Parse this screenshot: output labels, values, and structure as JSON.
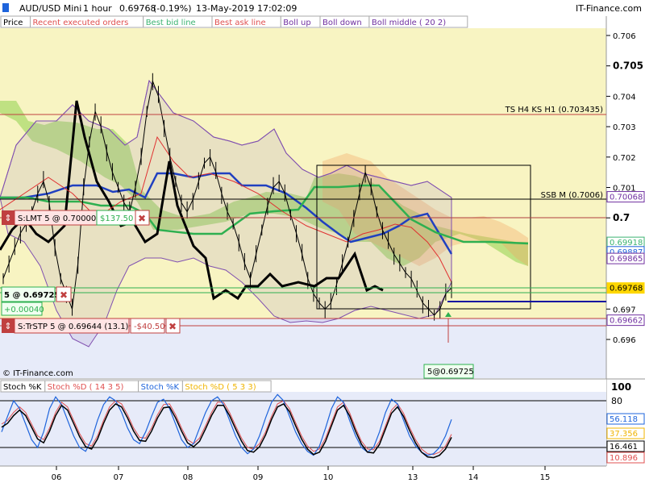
{
  "header": {
    "symbol": "AUD/USD Mini",
    "timeframe": "1 hour",
    "last_price": "0.69768",
    "change": "(-0.19%)",
    "datetime": "13-May-2019 17:02:09",
    "brand": "IT-Finance.com",
    "watermark": "© IT-Finance.com"
  },
  "legend": {
    "items": [
      {
        "label": "Price",
        "color": "#000000",
        "bg": "#ffffff"
      },
      {
        "label": "Recent executed orders",
        "color": "#e05050",
        "bg": "#ffffff"
      },
      {
        "label": "Best bid line",
        "color": "#3cb371",
        "bg": "#ffffff"
      },
      {
        "label": "Best ask line",
        "color": "#e05050",
        "bg": "#ffffff"
      },
      {
        "label": "Boll up",
        "color": "#7030a0",
        "bg": "#ffffff"
      },
      {
        "label": "Boll down",
        "color": "#7030a0",
        "bg": "#ffffff"
      },
      {
        "label": "Boll middle ( 20 2)",
        "color": "#7030a0",
        "bg": "#ffffff"
      }
    ]
  },
  "annotations": {
    "ts_label": "TS H4 KS H1 (0.703435)",
    "ssb_label": "SSB M (0.7006)"
  },
  "orders": {
    "limit_label": "S:LMT  5 @ 0.70000",
    "limit_value": "$137.50",
    "position_label": "5 @ 0.69725",
    "position_pnl": "+0.00040",
    "stop_label": "S:TrSTP  5 @ 0.69644 (13.1)",
    "stop_value": "-$40.50",
    "fill_label": "5@0.69725"
  },
  "stoch": {
    "legend": [
      {
        "label": "Stoch %K",
        "color": "#000000"
      },
      {
        "label": "Stoch %D ( 14 3 5)",
        "color": "#e05050"
      },
      {
        "label": "Stoch %K",
        "color": "#1e64dc"
      },
      {
        "label": "Stoch %D ( 5 3 3)",
        "color": "#f0b400"
      }
    ],
    "level_top": "100",
    "level_80": "80",
    "badges": [
      {
        "text": "56.118",
        "color": "#1e64dc"
      },
      {
        "text": "37.356",
        "color": "#f0b400"
      },
      {
        "text": "16.461",
        "color": "#000000"
      },
      {
        "text": "10.896",
        "color": "#e05050"
      }
    ]
  },
  "chart_data": {
    "type": "line",
    "symbol": "AUD/USD Mini",
    "interval": "1 hour",
    "ylim": [
      0.6955,
      0.7065
    ],
    "y_ticks": [
      "0.706",
      "0.705",
      "0.704",
      "0.703",
      "0.702",
      "0.701",
      "0.7",
      "0.697",
      "0.696"
    ],
    "x_tick_labels": [
      "06",
      "07",
      "08",
      "09",
      "10",
      "13",
      "14",
      "15"
    ],
    "price_badges": [
      {
        "text": "0.70068",
        "value": 0.70068,
        "color": "#7030a0"
      },
      {
        "text": "0.69918",
        "value": 0.69918,
        "color": "#3cb371"
      },
      {
        "text": "0.69887",
        "value": 0.69887,
        "color": "#1e64dc"
      },
      {
        "text": "0.69865",
        "value": 0.69865,
        "color": "#7030a0"
      },
      {
        "text": "0.69768",
        "value": 0.69768,
        "color": "#ffd700"
      },
      {
        "text": "0.69662",
        "value": 0.69662,
        "color": "#7030a0"
      }
    ],
    "horizontal_levels": [
      {
        "name": "TS H4 KS H1",
        "value": 0.703435
      },
      {
        "name": "SSB M",
        "value": 0.7006
      },
      {
        "name": "Limit order",
        "value": 0.7
      },
      {
        "name": "Position",
        "value": 0.69725
      },
      {
        "name": "Trailing stop",
        "value": 0.69644
      }
    ],
    "close_series": [
      0.698,
      0.6985,
      0.699,
      0.6995,
      0.6998,
      0.7002,
      0.7008,
      0.7012,
      0.7005,
      0.699,
      0.698,
      0.6975,
      0.697,
      0.6985,
      0.701,
      0.7025,
      0.7035,
      0.703,
      0.7022,
      0.7015,
      0.701,
      0.7005,
      0.7002,
      0.701,
      0.702,
      0.7035,
      0.7045,
      0.704,
      0.703,
      0.702,
      0.7012,
      0.7005,
      0.7002,
      0.7006,
      0.7012,
      0.7018,
      0.702,
      0.7015,
      0.7008,
      0.7002,
      0.6998,
      0.6992,
      0.6985,
      0.698,
      0.6988,
      0.6996,
      0.7004,
      0.701,
      0.7012,
      0.7008,
      0.7001,
      0.6995,
      0.6988,
      0.698,
      0.6975,
      0.6972,
      0.697,
      0.6972,
      0.6978,
      0.6985,
      0.6992,
      0.7,
      0.7008,
      0.7015,
      0.701,
      0.7002,
      0.6996,
      0.6992,
      0.6988,
      0.6985,
      0.6982,
      0.698,
      0.6976,
      0.6972,
      0.697,
      0.6968,
      0.697,
      0.6975,
      0.6977
    ],
    "stoch_k_series": [
      40,
      60,
      80,
      70,
      50,
      30,
      20,
      40,
      70,
      85,
      75,
      55,
      35,
      20,
      15,
      30,
      55,
      75,
      85,
      80,
      65,
      45,
      30,
      25,
      40,
      60,
      78,
      82,
      70,
      50,
      30,
      20,
      25,
      45,
      65,
      80,
      85,
      75,
      55,
      35,
      20,
      12,
      18,
      35,
      58,
      78,
      88,
      80,
      60,
      40,
      25,
      15,
      10,
      22,
      45,
      70,
      85,
      78,
      55,
      35,
      20,
      14,
      20,
      40,
      65,
      82,
      76,
      55,
      35,
      22,
      14,
      10,
      12,
      20,
      35,
      56
    ],
    "stoch_d_series": [
      50,
      55,
      65,
      72,
      65,
      50,
      35,
      30,
      45,
      65,
      78,
      72,
      55,
      38,
      25,
      22,
      35,
      55,
      72,
      80,
      76,
      62,
      45,
      33,
      32,
      45,
      62,
      75,
      76,
      62,
      45,
      30,
      25,
      32,
      48,
      65,
      78,
      78,
      65,
      48,
      32,
      20,
      18,
      25,
      40,
      60,
      76,
      80,
      70,
      52,
      35,
      22,
      15,
      18,
      32,
      52,
      72,
      78,
      65,
      45,
      28,
      18,
      17,
      28,
      48,
      68,
      76,
      64,
      46,
      30,
      18,
      12,
      11,
      14,
      22,
      37
    ]
  }
}
